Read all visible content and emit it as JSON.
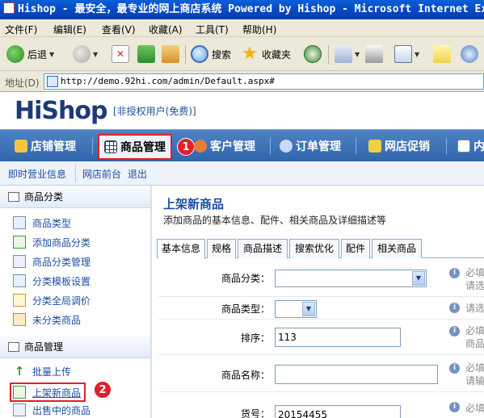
{
  "window": {
    "title": "Hishop - 最安全，最专业的网上商店系统 Powered by Hishop - Microsoft Internet Explorer"
  },
  "menu": [
    "文件(F)",
    "编辑(E)",
    "查看(V)",
    "收藏(A)",
    "工具(T)",
    "帮助(H)"
  ],
  "toolbar": {
    "back_label": "后退",
    "search_label": "搜索",
    "favorites_label": "收藏夹"
  },
  "address": {
    "label": "地址(D)",
    "url": "http://demo.92hi.com/admin/Default.aspx#"
  },
  "header": {
    "logo": "HiShop",
    "user_status": "[非授权用户(免费)]"
  },
  "nav": {
    "items": [
      "店铺管理",
      "商品管理",
      "客户管理",
      "订单管理",
      "网店促销",
      "内"
    ],
    "active_index": 1,
    "callout_1": "1"
  },
  "subnav": {
    "business_info": "即时营业信息",
    "storefront": "网店前台",
    "logout": "退出"
  },
  "sidebar": {
    "category_heading": "商品分类",
    "category_items": [
      "商品类型",
      "添加商品分类",
      "商品分类管理",
      "分类模板设置",
      "分类全局调价",
      "未分类商品"
    ],
    "product_heading": "商品管理",
    "product_items": [
      "批量上传",
      "上架新商品",
      "出售中的商品"
    ],
    "callout_2": "2"
  },
  "content": {
    "title": "上架新商品",
    "description": "添加商品的基本信息、配件、相关商品及详细描述等",
    "tabs": [
      "基本信息",
      "规格",
      "商品描述",
      "搜索优化",
      "配件",
      "相关商品"
    ],
    "fields": {
      "category_label": "商品分类：",
      "category_value": "",
      "category_hint1": "必填",
      "category_hint2": "请选",
      "type_label": "商品类型：",
      "type_value": "",
      "type_hint": "请选",
      "sort_label": "排序：",
      "sort_value": "113",
      "sort_hint1": "必填",
      "sort_hint2": "商品",
      "name_label": "商品名称：",
      "name_value": "",
      "name_hint1": "必填",
      "name_hint2": "请输",
      "code_label": "货号：",
      "code_value": "20154455",
      "code_hint": "必填"
    }
  }
}
